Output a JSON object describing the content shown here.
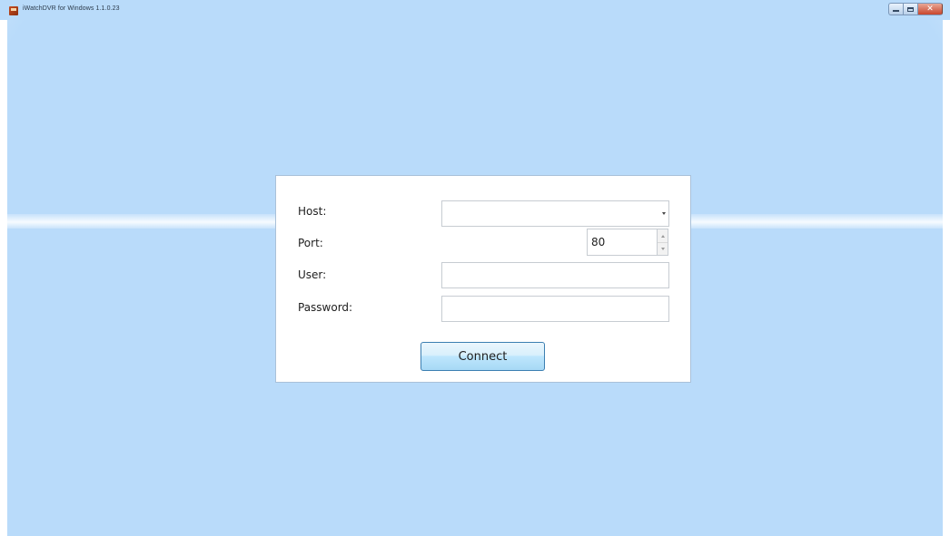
{
  "window": {
    "title": "iWatchDVR for Windows 1.1.0.23",
    "controls": {
      "minimize": "minimize-icon",
      "maximize": "maximize-icon",
      "close": "close-icon"
    }
  },
  "colors": {
    "background": "#b9dbfa",
    "panel": "#ffffff",
    "button_border": "#3c7fb1"
  },
  "login": {
    "host_label": "Host:",
    "host_value": "",
    "port_label": "Port:",
    "port_value": "80",
    "user_label": "User:",
    "user_value": "",
    "password_label": "Password:",
    "password_value": "",
    "connect_label": "Connect"
  }
}
